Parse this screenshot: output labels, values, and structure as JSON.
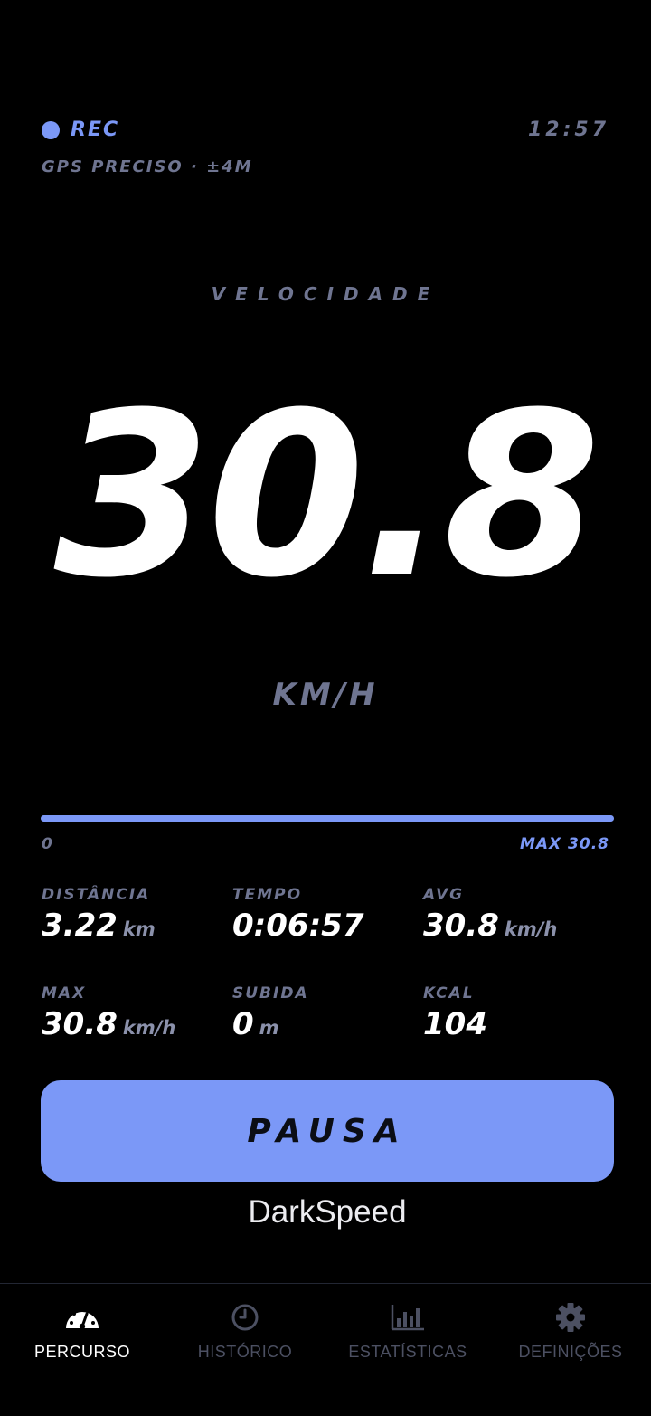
{
  "status": {
    "rec_label": "REC",
    "clock": "12:57",
    "gps": "GPS PRECISO · ±4M"
  },
  "speed": {
    "label": "VELOCIDADE",
    "value": "30.8",
    "unit": "KM/H"
  },
  "progress": {
    "fraction": 1.0,
    "min_label": "0",
    "max_label": "MAX 30.8"
  },
  "stats": [
    {
      "label": "DISTÂNCIA",
      "value": "3.22",
      "unit": "km"
    },
    {
      "label": "TEMPO",
      "value": "0:06:57",
      "unit": ""
    },
    {
      "label": "AVG",
      "value": "30.8",
      "unit": "km/h"
    },
    {
      "label": "MAX",
      "value": "30.8",
      "unit": "km/h"
    },
    {
      "label": "SUBIDA",
      "value": "0",
      "unit": "m"
    },
    {
      "label": "KCAL",
      "value": "104",
      "unit": ""
    }
  ],
  "pause_button": {
    "label": "PAUSA"
  },
  "app_name": "DarkSpeed",
  "nav": {
    "items": [
      {
        "label": "PERCURSO",
        "icon": "speedometer-icon",
        "active": true
      },
      {
        "label": "HISTÓRICO",
        "icon": "clock-icon",
        "active": false
      },
      {
        "label": "ESTATÍSTICAS",
        "icon": "bar-chart-icon",
        "active": false
      },
      {
        "label": "DEFINIÇÕES",
        "icon": "gear-icon",
        "active": false
      }
    ]
  },
  "colors": {
    "accent": "#7b98f7",
    "muted": "#6f7591",
    "background": "#000000",
    "nav_inactive": "#4c5062"
  }
}
